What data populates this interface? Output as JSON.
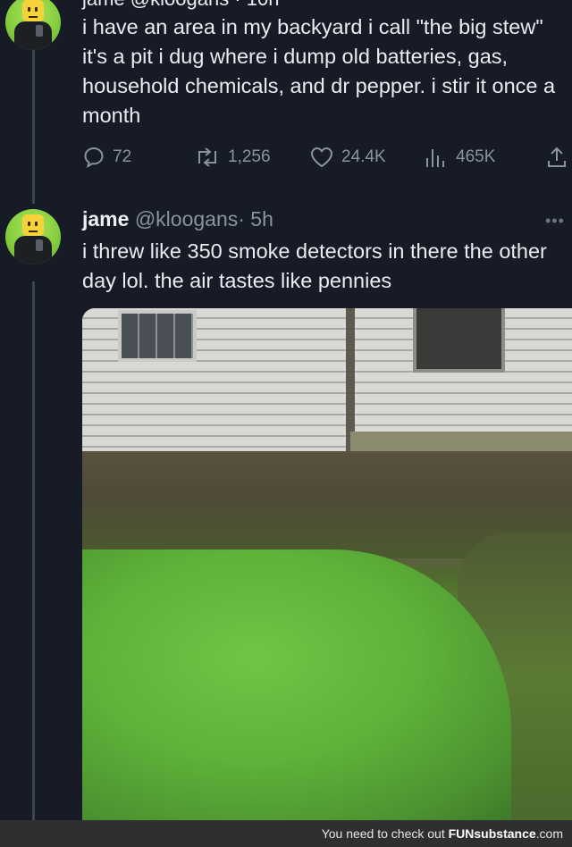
{
  "tweet1": {
    "header_cut": "jame @kloogans · 10h",
    "text": "i have an area in my backyard i call \"the big stew\" it's a pit i dug where i dump old batteries, gas, household chemicals, and dr pepper. i stir it once a month",
    "replies": "72",
    "retweets": "1,256",
    "likes": "24.4K",
    "views": "465K"
  },
  "tweet2": {
    "name": "jame",
    "handle": "@kloogans",
    "time": "· 5h",
    "more": "•••",
    "text": "i threw like 350 smoke detectors in there the other day lol. the air tastes like pennies"
  },
  "footer": {
    "prefix": "You need to check out ",
    "brand": "FUNsubstance",
    "suffix": ".com"
  },
  "icons": [
    "reply-icon",
    "retweet-icon",
    "like-icon",
    "views-icon",
    "share-icon",
    "more-icon"
  ],
  "colors": {
    "background": "#171b26",
    "muted": "#8b93a1",
    "text": "#e9ecf1"
  }
}
